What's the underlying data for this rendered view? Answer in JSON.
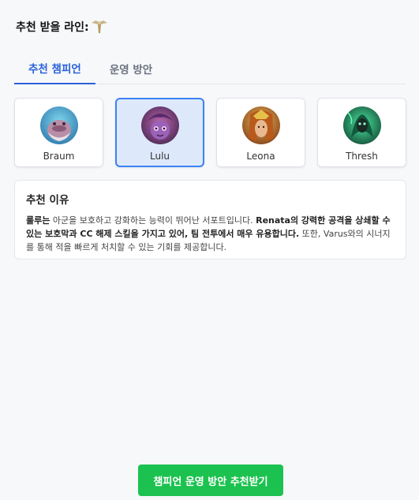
{
  "header": {
    "title": "추천 받을 라인:",
    "role_icon": "support-role-icon"
  },
  "tabs": [
    {
      "label": "추천 챔피언",
      "active": true
    },
    {
      "label": "운영 방안",
      "active": false
    }
  ],
  "champions": [
    {
      "name": "Braum",
      "selected": false
    },
    {
      "name": "Lulu",
      "selected": true
    },
    {
      "name": "Leona",
      "selected": false
    },
    {
      "name": "Thresh",
      "selected": false
    }
  ],
  "reason": {
    "title": "추천 이유",
    "champion_name": "룰루는",
    "text1": " 아군을 보호하고 강화하는 능력이 뛰어난 서포트입니다. ",
    "bold1": "Renata의 강력한 공격을 상쇄할 수 있는 보호막과 CC 해제 스킬을 가지고 있어, 팀 전투에서 매우 유용합니다.",
    "text2": " 또한, Varus와의 시너지를 통해 적을 빠르게 처치할 수 있는 기회를 제공합니다."
  },
  "cta": {
    "label": "챔피언 운영 방안 추천받기"
  },
  "colors": {
    "accent": "#2962d8",
    "cta": "#1cc24f",
    "selected_bg": "#dde9fb",
    "selected_border": "#3b82f6"
  }
}
